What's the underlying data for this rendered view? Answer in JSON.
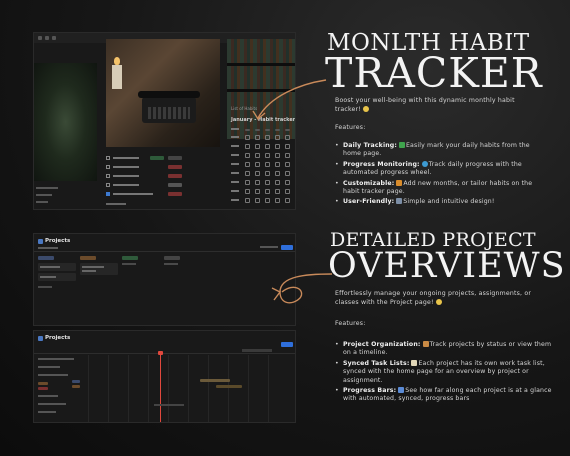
{
  "section1": {
    "title_line1": "MONLTH HABIT",
    "title_line2": "TRACKER",
    "intro": "Boost your well-being with this dynamic monthly habit tracker!",
    "features_label": "Features:",
    "features": [
      {
        "name": "Daily Tracking:",
        "text": "Easily mark your daily habits from the home page.",
        "icon": "check-box-emoji",
        "color": "#3fa34d"
      },
      {
        "name": "Progress Monitoring:",
        "text": "Track daily progress with the automated progress wheel.",
        "icon": "progress-circle-emoji",
        "color": "#3d9ad1"
      },
      {
        "name": "Customizable:",
        "text": "Add new months, or tailor habits on the habit tracker page.",
        "icon": "palette-emoji",
        "color": "#d98c2b"
      },
      {
        "name": "User-Friendly:",
        "text": "Simple and intuitive design!",
        "icon": "computer-emoji",
        "color": "#7c8ea6"
      }
    ],
    "screenshot": {
      "tracker_heading": "January - Habit tracker",
      "list_heading": "List of Habits"
    }
  },
  "section2": {
    "title_line1": "DETAILED PROJECT",
    "title_line2": "OVERVIEWS",
    "intro": "Effortlessly manage your ongoing projects, assignments, or classes with the Project page!",
    "features_label": "Features:",
    "features": [
      {
        "name": "Project Organization:",
        "text": "Track projects by status or view them on a timeline.",
        "icon": "folder-emoji",
        "color": "#c98a45"
      },
      {
        "name": "Synced Task Lists:",
        "text": "Each project has its own work task list, synced with the home page for an overview by project or assignment.",
        "icon": "memo-emoji",
        "color": "#e1d7b8"
      },
      {
        "name": "Progress Bars:",
        "text": "See how far along each project is at a glance with automated, synced, progress bars",
        "icon": "bar-chart-emoji",
        "color": "#5b8bd6"
      }
    ],
    "screenshot_board_title": "Projects",
    "screenshot_timeline_title": "Projects"
  },
  "colors": {
    "accent_arrow": "#c98a5a",
    "new_button": "#2f6fdb"
  }
}
